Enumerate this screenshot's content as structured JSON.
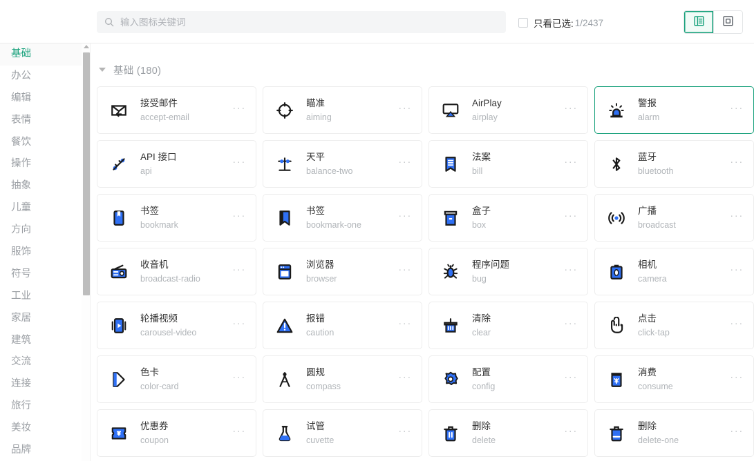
{
  "header": {
    "search": {
      "placeholder": "输入图标关键词",
      "value": "",
      "icon": "search-icon"
    },
    "only_selected": {
      "label": "只看已选:",
      "count": "1/2437",
      "checked": false
    },
    "view_modes": [
      {
        "name": "list-view",
        "icon": "list-view-icon",
        "active": true
      },
      {
        "name": "grid-view",
        "icon": "grid-view-icon",
        "active": false
      }
    ]
  },
  "sidebar": {
    "items": [
      {
        "label": "基础",
        "active": true
      },
      {
        "label": "办公",
        "active": false
      },
      {
        "label": "编辑",
        "active": false
      },
      {
        "label": "表情",
        "active": false
      },
      {
        "label": "餐饮",
        "active": false
      },
      {
        "label": "操作",
        "active": false
      },
      {
        "label": "抽象",
        "active": false
      },
      {
        "label": "儿童",
        "active": false
      },
      {
        "label": "方向",
        "active": false
      },
      {
        "label": "服饰",
        "active": false
      },
      {
        "label": "符号",
        "active": false
      },
      {
        "label": "工业",
        "active": false
      },
      {
        "label": "家居",
        "active": false
      },
      {
        "label": "建筑",
        "active": false
      },
      {
        "label": "交流",
        "active": false
      },
      {
        "label": "连接",
        "active": false
      },
      {
        "label": "旅行",
        "active": false
      },
      {
        "label": "美妆",
        "active": false
      },
      {
        "label": "品牌",
        "active": false
      }
    ]
  },
  "content": {
    "group_title": "基础 (180)",
    "more_glyph": "···",
    "cards": [
      {
        "cn": "接受邮件",
        "en": "accept-email",
        "icon": "accept-email-icon",
        "selected": false
      },
      {
        "cn": "瞄准",
        "en": "aiming",
        "icon": "aiming-icon",
        "selected": false
      },
      {
        "cn": "AirPlay",
        "en": "airplay",
        "icon": "airplay-icon",
        "selected": false
      },
      {
        "cn": "警报",
        "en": "alarm",
        "icon": "alarm-icon",
        "selected": true
      },
      {
        "cn": "API 接口",
        "en": "api",
        "icon": "api-icon",
        "selected": false
      },
      {
        "cn": "天平",
        "en": "balance-two",
        "icon": "balance-two-icon",
        "selected": false
      },
      {
        "cn": "法案",
        "en": "bill",
        "icon": "bill-icon",
        "selected": false
      },
      {
        "cn": "蓝牙",
        "en": "bluetooth",
        "icon": "bluetooth-icon",
        "selected": false
      },
      {
        "cn": "书签",
        "en": "bookmark",
        "icon": "bookmark-icon",
        "selected": false
      },
      {
        "cn": "书签",
        "en": "bookmark-one",
        "icon": "bookmark-one-icon",
        "selected": false
      },
      {
        "cn": "盒子",
        "en": "box",
        "icon": "box-icon",
        "selected": false
      },
      {
        "cn": "广播",
        "en": "broadcast",
        "icon": "broadcast-icon",
        "selected": false
      },
      {
        "cn": "收音机",
        "en": "broadcast-radio",
        "icon": "broadcast-radio-icon",
        "selected": false
      },
      {
        "cn": "浏览器",
        "en": "browser",
        "icon": "browser-icon",
        "selected": false
      },
      {
        "cn": "程序问题",
        "en": "bug",
        "icon": "bug-icon",
        "selected": false
      },
      {
        "cn": "相机",
        "en": "camera",
        "icon": "camera-icon",
        "selected": false
      },
      {
        "cn": "轮播视频",
        "en": "carousel-video",
        "icon": "carousel-video-icon",
        "selected": false
      },
      {
        "cn": "报错",
        "en": "caution",
        "icon": "caution-icon",
        "selected": false
      },
      {
        "cn": "清除",
        "en": "clear",
        "icon": "clear-icon",
        "selected": false
      },
      {
        "cn": "点击",
        "en": "click-tap",
        "icon": "click-tap-icon",
        "selected": false
      },
      {
        "cn": "色卡",
        "en": "color-card",
        "icon": "color-card-icon",
        "selected": false
      },
      {
        "cn": "圆规",
        "en": "compass",
        "icon": "compass-icon",
        "selected": false
      },
      {
        "cn": "配置",
        "en": "config",
        "icon": "config-icon",
        "selected": false
      },
      {
        "cn": "消费",
        "en": "consume",
        "icon": "consume-icon",
        "selected": false
      },
      {
        "cn": "优惠券",
        "en": "coupon",
        "icon": "coupon-icon",
        "selected": false
      },
      {
        "cn": "试管",
        "en": "cuvette",
        "icon": "cuvette-icon",
        "selected": false
      },
      {
        "cn": "删除",
        "en": "delete",
        "icon": "delete-icon",
        "selected": false
      },
      {
        "cn": "删除",
        "en": "delete-one",
        "icon": "delete-one-icon",
        "selected": false
      }
    ]
  },
  "colors": {
    "accent_green": "#15a07a",
    "icon_blue": "#2F70F4",
    "icon_dark": "#1a1a1a",
    "text_primary": "#333333",
    "text_muted": "#b1b5b9"
  }
}
